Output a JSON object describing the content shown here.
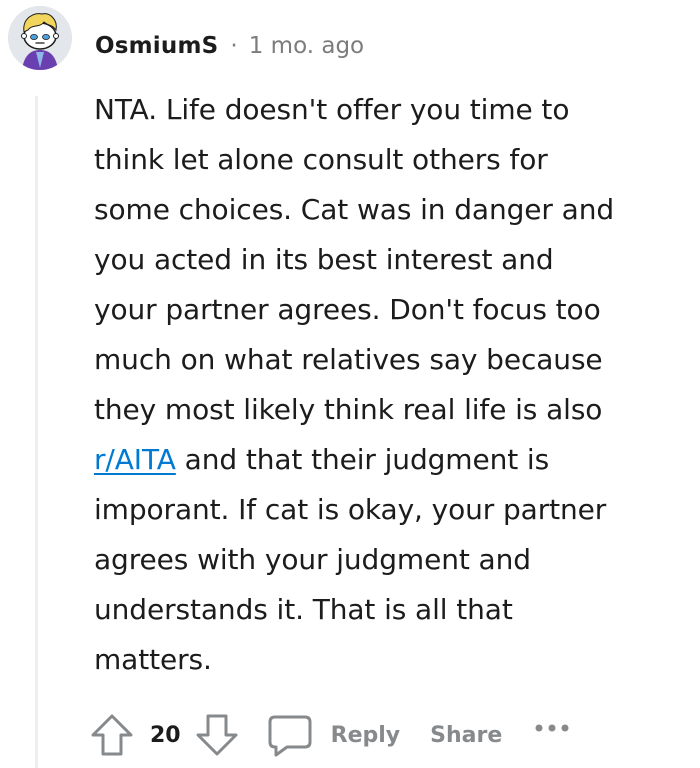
{
  "comment": {
    "author": "OsmiumS",
    "separator": "·",
    "timestamp": "1 mo. ago",
    "body_lines": [
      "NTA. Life doesn't offer you time to",
      "think let alone consult others for",
      "some choices. Cat was in danger and",
      "you acted in its best interest and",
      "your partner agrees. Don't focus too",
      "much on what relatives say because",
      "they most likely think real life is also"
    ],
    "subreddit_link": "r/AITA",
    "body_after_link": " and that their judgment is",
    "body_tail_lines": [
      "imporant. If cat is okay, your partner",
      "agrees with your judgment and",
      "understands it. That is all that",
      "matters."
    ]
  },
  "actions": {
    "vote_count": "20",
    "reply_label": "Reply",
    "share_label": "Share",
    "upvote_icon": "arrow-up-outline",
    "downvote_icon": "arrow-down-outline",
    "reply_icon": "speech-bubble",
    "more_icon": "ellipsis-horizontal"
  },
  "colors": {
    "text": "#1c1c1c",
    "muted": "#7c7c7c",
    "action_gray": "#878a8c",
    "link": "#0079d3",
    "thread_line": "#edeff1"
  }
}
